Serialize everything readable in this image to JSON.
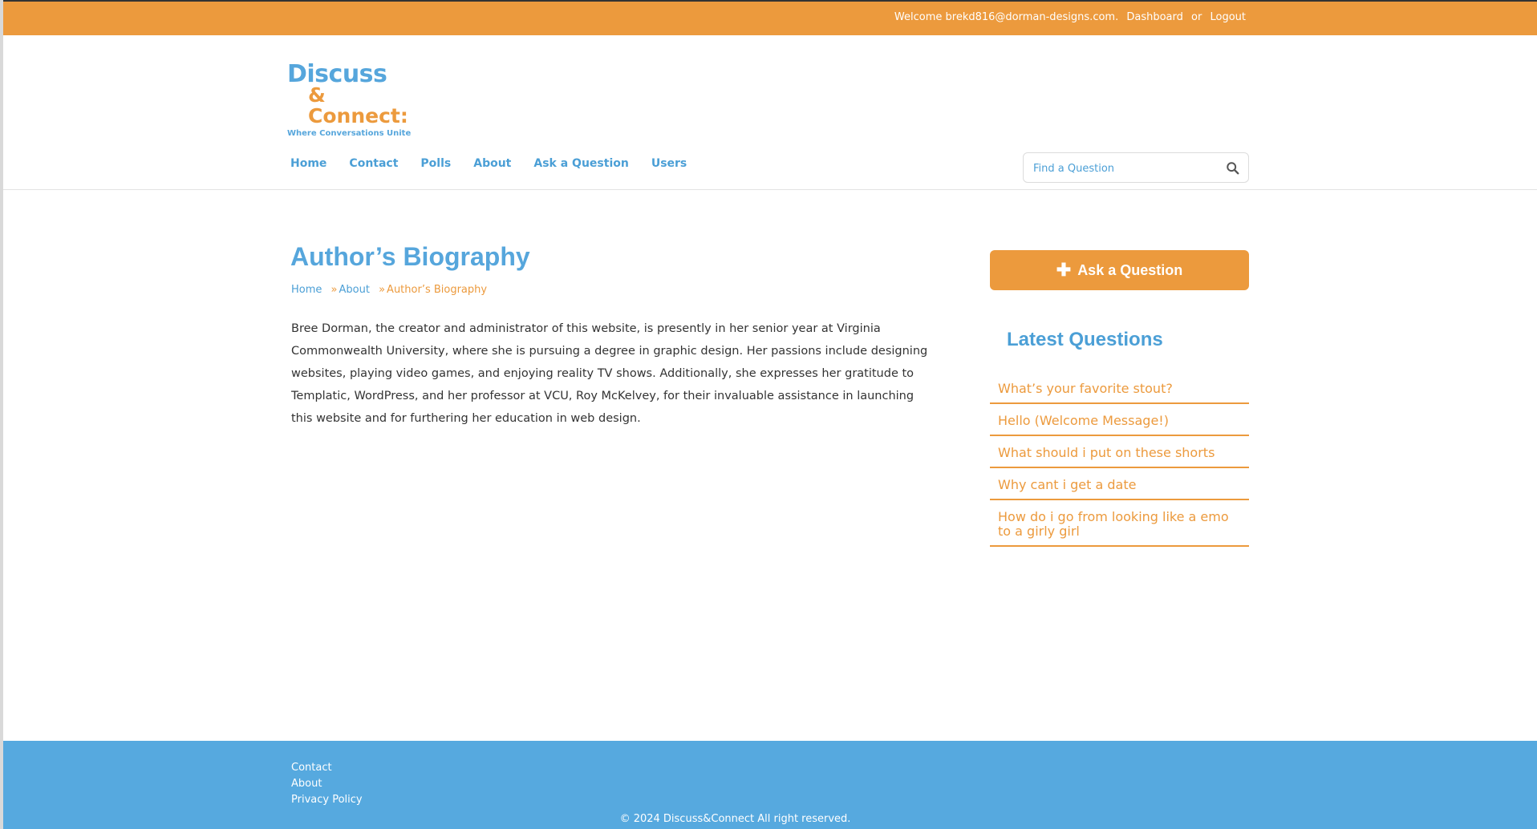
{
  "topbar": {
    "welcome": "Welcome brekd816@dorman-designs.com.",
    "dashboard": "Dashboard",
    "or": "or",
    "logout": "Logout"
  },
  "logo": {
    "line1": "Discuss",
    "line2": "& Connect:",
    "tagline": "Where Conversations Unite"
  },
  "nav": {
    "items": [
      {
        "label": "Home"
      },
      {
        "label": "Contact"
      },
      {
        "label": "Polls"
      },
      {
        "label": "About"
      },
      {
        "label": "Ask a Question"
      },
      {
        "label": "Users"
      }
    ]
  },
  "search": {
    "placeholder": "Find a Question",
    "icon": "search-icon"
  },
  "main": {
    "title": "Author’s Biography",
    "breadcrumb": {
      "home": "Home",
      "sep": "»",
      "about": "About",
      "current": "Author’s Biography"
    },
    "body": "Bree Dorman, the creator and administrator of this website, is presently in her senior year at Virginia Commonwealth University, where she is pursuing a degree in graphic design. Her passions include designing websites, playing video games, and enjoying reality TV shows. Additionally, she expresses her gratitude to Templatic, WordPress, and her professor at VCU, Roy McKelvey, for their invaluable assistance in launching this website and for furthering her education in web design."
  },
  "sidebar": {
    "ask_button": "Ask a Question",
    "ask_icon": "plus-icon",
    "latest_title": "Latest Questions",
    "questions": [
      {
        "label": "What’s your favorite stout?"
      },
      {
        "label": "Hello (Welcome Message!)"
      },
      {
        "label": "What should i put on these shorts"
      },
      {
        "label": "Why cant i get a date"
      },
      {
        "label": "How do i go from looking like a emo to a girly girl"
      }
    ]
  },
  "footer": {
    "links": [
      {
        "label": "Contact"
      },
      {
        "label": "About"
      },
      {
        "label": "Privacy Policy"
      }
    ],
    "copyright": "© 2024 Discuss&Connect All right reserved."
  },
  "colors": {
    "orange": "#ec9a3d",
    "blue": "#56a6dc",
    "footer_blue": "#56a9df"
  }
}
